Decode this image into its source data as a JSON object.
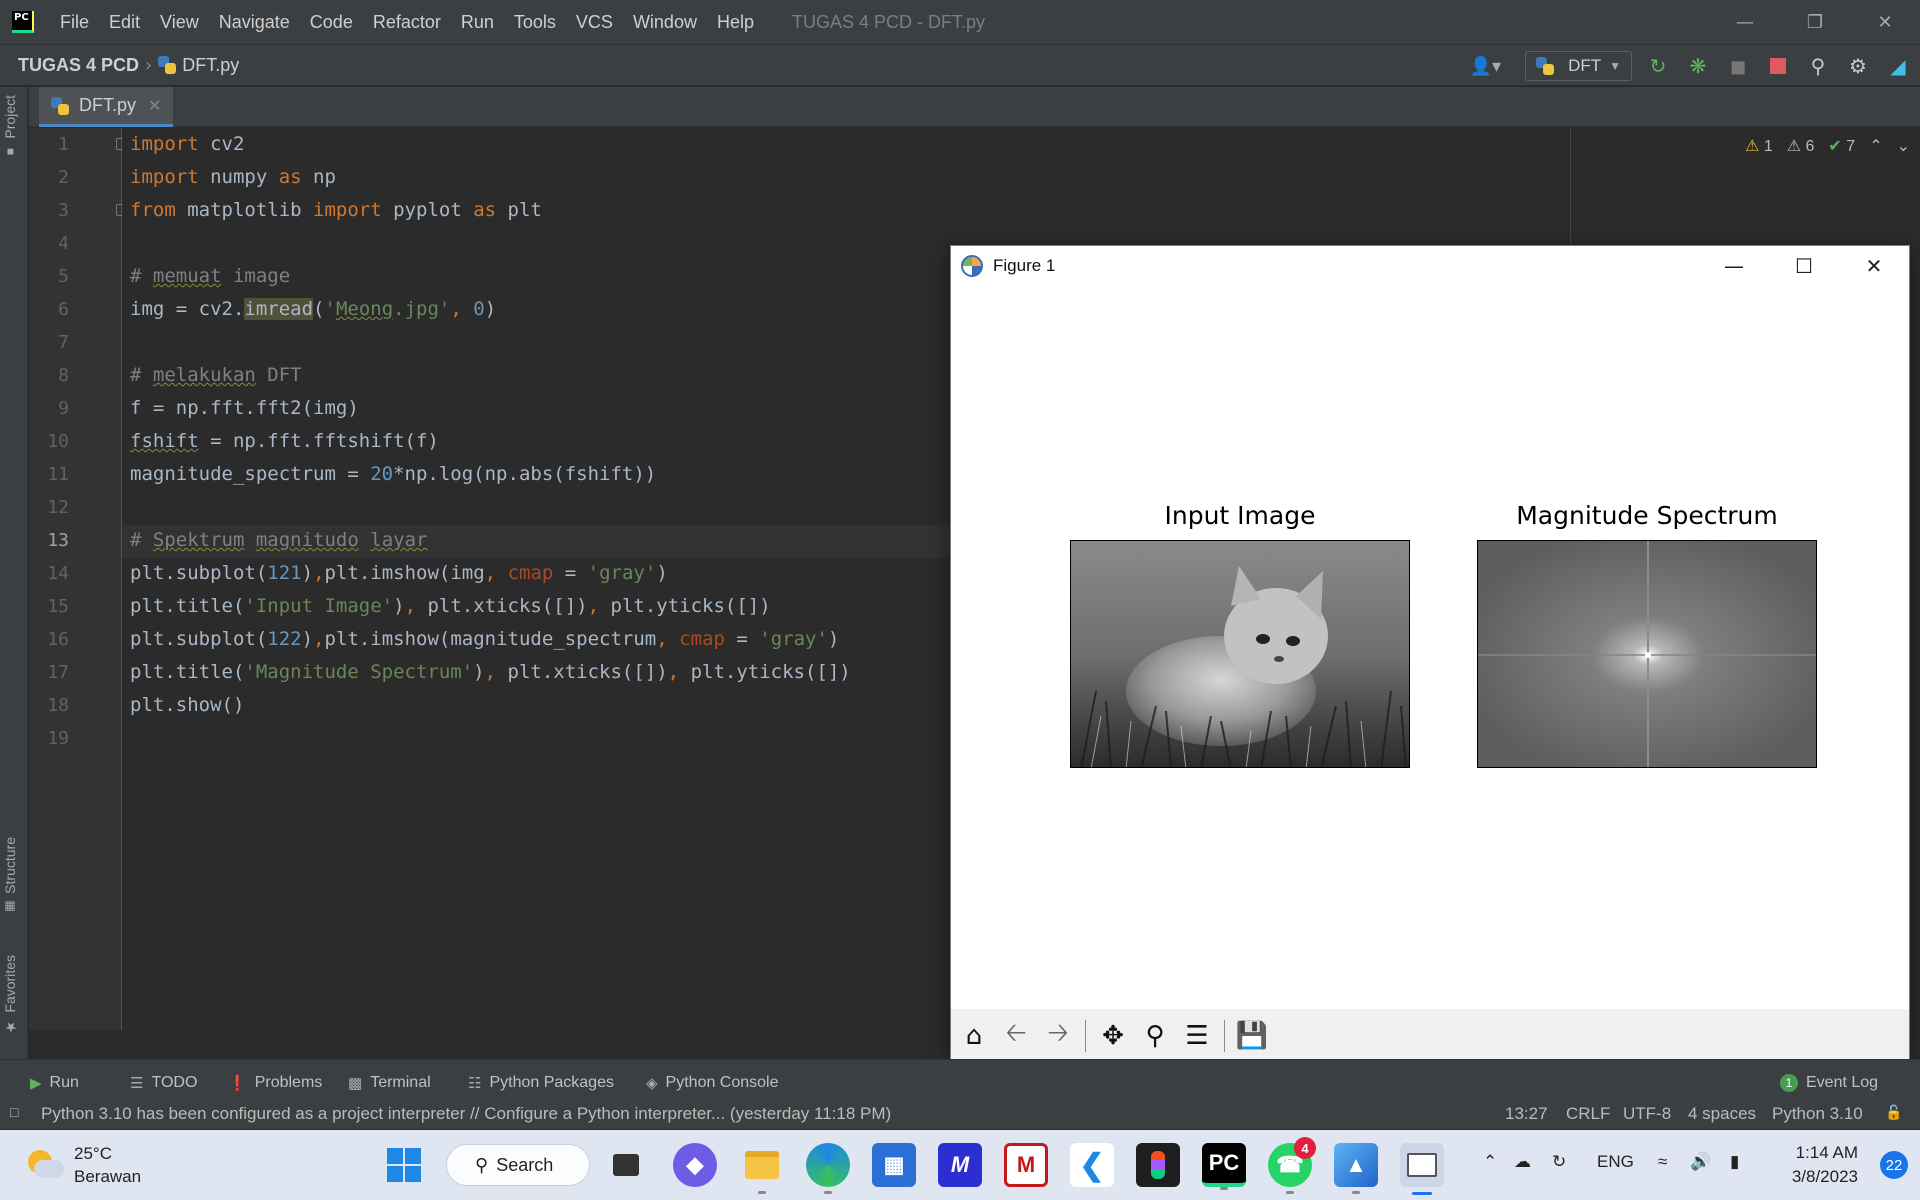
{
  "app": {
    "logo": "PC",
    "window_title": "TUGAS 4 PCD - DFT.py",
    "menu": [
      "File",
      "Edit",
      "View",
      "Navigate",
      "Code",
      "Refactor",
      "Run",
      "Tools",
      "VCS",
      "Window",
      "Help"
    ]
  },
  "nav": {
    "project": "TUGAS 4 PCD",
    "file": "DFT.py",
    "run_config": "DFT"
  },
  "left_strip": {
    "project": "Project",
    "structure": "Structure",
    "favorites": "Favorites"
  },
  "editor": {
    "tab": "DFT.py",
    "inspections": {
      "errors": "1",
      "warnings": "6",
      "weak": "7"
    },
    "line_numbers": [
      "1",
      "2",
      "3",
      "4",
      "5",
      "6",
      "7",
      "8",
      "9",
      "10",
      "11",
      "12",
      "13",
      "14",
      "15",
      "16",
      "17",
      "18",
      "19"
    ],
    "lines": [
      "import cv2",
      "import numpy as np",
      "from matplotlib import pyplot as plt",
      "",
      "# memuat image",
      "img = cv2.imread('Meong.jpg', 0)",
      "",
      "# melakukan DFT",
      "f = np.fft.fft2(img)",
      "fshift = np.fft.fftshift(f)",
      "magnitude_spectrum = 20*np.log(np.abs(fshift))",
      "",
      "# Spektrum magnitudo layar",
      "plt.subplot(121),plt.imshow(img, cmap = 'gray')",
      "plt.title('Input Image'), plt.xticks([]), plt.yticks([])",
      "plt.subplot(122),plt.imshow(magnitude_spectrum, cmap = 'gray')",
      "plt.title('Magnitude Spectrum'), plt.xticks([]), plt.yticks([])",
      "plt.show()",
      ""
    ]
  },
  "figure": {
    "title": "Figure 1",
    "left_title": "Input Image",
    "right_title": "Magnitude Spectrum",
    "toolbar": [
      "home-icon",
      "back-icon",
      "forward-icon",
      "pan-icon",
      "zoom-icon",
      "configure-icon",
      "save-icon"
    ]
  },
  "bottom_tools": {
    "run": "Run",
    "todo": "TODO",
    "problems": "Problems",
    "terminal": "Terminal",
    "packages": "Python Packages",
    "console": "Python Console",
    "event_log": "Event Log",
    "event_count": "1"
  },
  "status": {
    "message": "Python 3.10 has been configured as a project interpreter // Configure a Python interpreter... (yesterday 11:18 PM)",
    "position": "13:27",
    "line_sep": "CRLF",
    "encoding": "UTF-8",
    "indent": "4 spaces",
    "interpreter": "Python 3.10"
  },
  "taskbar": {
    "temperature": "25°C",
    "weather": "Berawan",
    "search": "Search",
    "whatsapp_badge": "4",
    "language": "ENG",
    "time": "1:14 AM",
    "date": "3/8/2023",
    "notifications": "22"
  },
  "colors": {
    "editor_bg": "#2b2b2b",
    "keyword": "#cc7832",
    "string": "#6a8759",
    "number": "#6897bb",
    "comment": "#808080",
    "accent": "#4a88c7"
  }
}
